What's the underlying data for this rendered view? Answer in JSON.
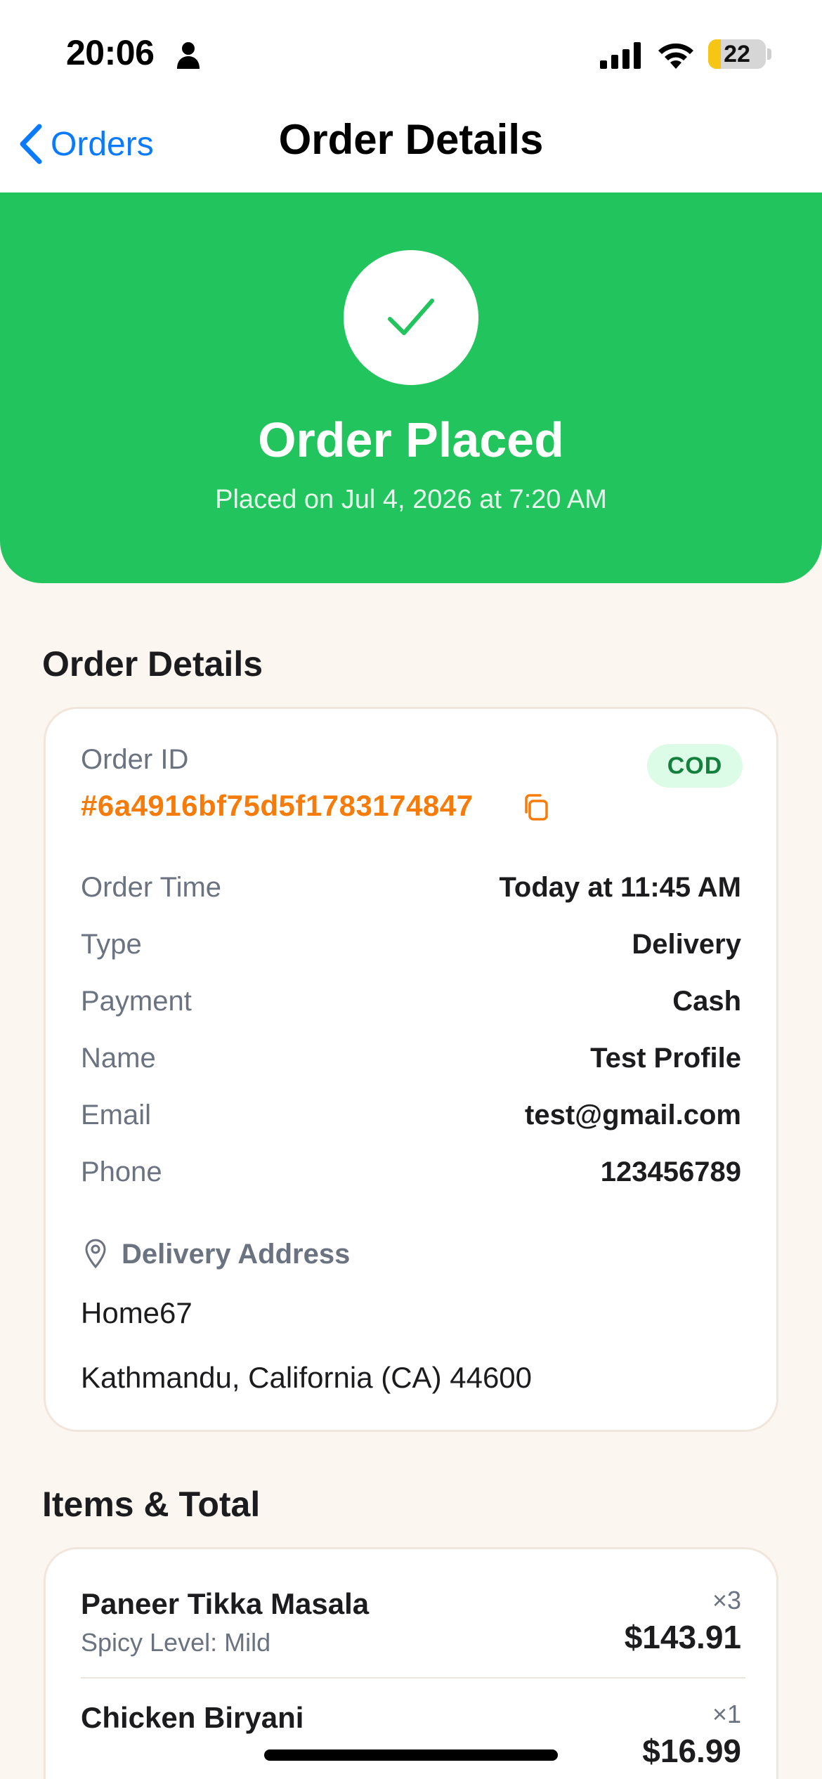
{
  "status_bar": {
    "time": "20:06",
    "battery": "22",
    "battery_level": 0.22
  },
  "nav": {
    "back_label": "Orders",
    "title": "Order Details"
  },
  "hero": {
    "title": "Order Placed",
    "subtitle": "Placed on Jul 4, 2026 at 7:20 AM",
    "color": "#22c45e"
  },
  "order_details": {
    "heading": "Order Details",
    "order_id_label": "Order ID",
    "order_id": "#6a4916bf75d5f1783174847",
    "payment_badge": "COD",
    "rows": [
      {
        "label": "Order Time",
        "value": "Today at 11:45 AM"
      },
      {
        "label": "Type",
        "value": "Delivery"
      },
      {
        "label": "Payment",
        "value": "Cash"
      },
      {
        "label": "Name",
        "value": "Test Profile"
      },
      {
        "label": "Email",
        "value": "test@gmail.com"
      },
      {
        "label": "Phone",
        "value": "123456789"
      }
    ],
    "address_heading": "Delivery Address",
    "address_line1": "Home67",
    "address_line2": "Kathmandu, California (CA) 44600"
  },
  "items": {
    "heading": "Items & Total",
    "list": [
      {
        "name": "Paneer Tikka Masala",
        "sub": "Spicy Level: Mild",
        "qty": "×3",
        "price": "$143.91"
      },
      {
        "name": "Chicken Biryani",
        "sub": "",
        "qty": "×1",
        "price": "$16.99"
      }
    ]
  },
  "colors": {
    "accent_orange": "#f57c0a",
    "link_blue": "#0a7aff",
    "badge_green": "#15803d"
  }
}
